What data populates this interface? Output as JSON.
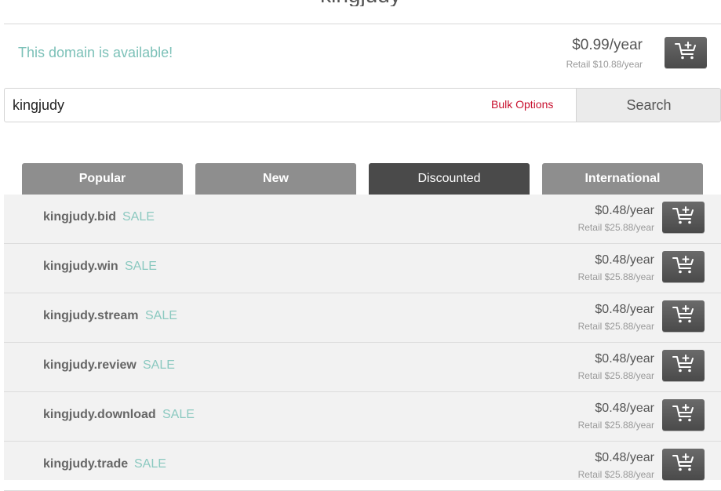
{
  "header": {
    "title": "kingjudy"
  },
  "availability": {
    "message": "This domain is available!",
    "price": "$0.99/year",
    "retail": "Retail $10.88/year",
    "cart_icon": "add-to-cart-icon"
  },
  "search": {
    "value": "kingjudy",
    "bulk_label": "Bulk Options",
    "button_label": "Search"
  },
  "tabs": [
    {
      "label": "Popular",
      "active": false
    },
    {
      "label": "New",
      "active": false
    },
    {
      "label": "Discounted",
      "active": true
    },
    {
      "label": "International",
      "active": false
    }
  ],
  "results": [
    {
      "domain": "kingjudy.bid",
      "badge": "SALE",
      "price": "$0.48/year",
      "retail": "Retail $25.88/year"
    },
    {
      "domain": "kingjudy.win",
      "badge": "SALE",
      "price": "$0.48/year",
      "retail": "Retail $25.88/year"
    },
    {
      "domain": "kingjudy.stream",
      "badge": "SALE",
      "price": "$0.48/year",
      "retail": "Retail $25.88/year"
    },
    {
      "domain": "kingjudy.review",
      "badge": "SALE",
      "price": "$0.48/year",
      "retail": "Retail $25.88/year"
    },
    {
      "domain": "kingjudy.download",
      "badge": "SALE",
      "price": "$0.48/year",
      "retail": "Retail $25.88/year"
    },
    {
      "domain": "kingjudy.trade",
      "badge": "SALE",
      "price": "$0.48/year",
      "retail": "Retail $25.88/year"
    }
  ],
  "colors": {
    "available_text": "#7cc1b8",
    "sale_badge": "#8bc9c0",
    "bulk_link": "#c8102e",
    "tab_active": "#4a4a4a",
    "tab_inactive": "#8e8e8e"
  }
}
